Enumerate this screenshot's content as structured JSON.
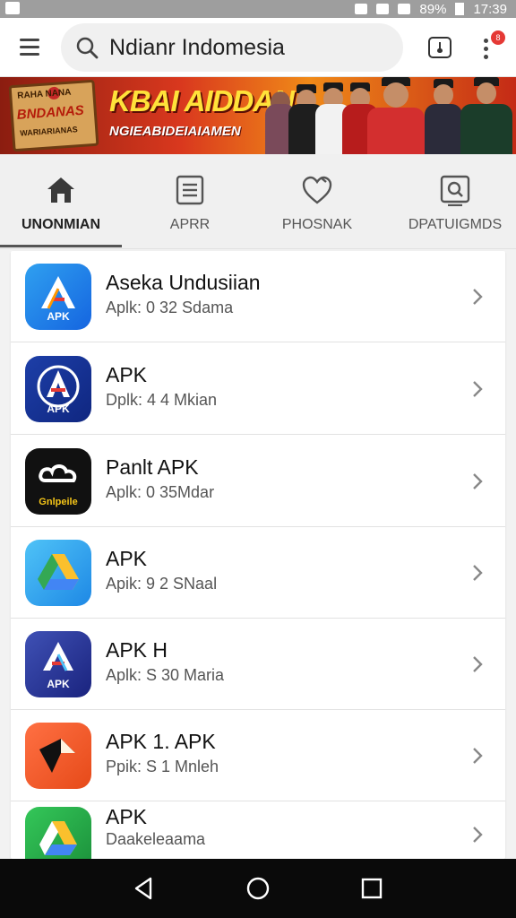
{
  "status_bar": {
    "battery": "89%",
    "time": "17:39"
  },
  "top_bar": {
    "search_value": "Ndianr Indomesia",
    "notification_count": "8"
  },
  "banner": {
    "sign_line1": "RAHA NANA",
    "sign_line2": "BNDANAS",
    "sign_line3": "WARIARIANAS",
    "title": "KBAI AIDDAN",
    "subtitle": "NGIEABIDEIAIAMEN"
  },
  "tabs": [
    {
      "label": "UNONMIAN",
      "icon": "home-icon",
      "active": true
    },
    {
      "label": "APRR",
      "icon": "document-icon",
      "active": false
    },
    {
      "label": "PHOSNAK",
      "icon": "heart-icon",
      "active": false
    },
    {
      "label": "DPATUIGMDS",
      "icon": "search-window-icon",
      "active": false
    }
  ],
  "apps": [
    {
      "name": "Aseka Undusiian",
      "meta": "Aplk: 0 32 Sdama",
      "icon": "apk-icon-blue",
      "caption": "APK",
      "colors": [
        "#2fa0f0",
        "#1565e0"
      ]
    },
    {
      "name": "APK",
      "meta": "Dplk: 4 4 Mkian",
      "icon": "apk-icon-navy",
      "caption": "APK",
      "colors": [
        "#1d3fa8",
        "#0f2680"
      ]
    },
    {
      "name": "Panlt APK",
      "meta": "Aplk: 0 35Mdar",
      "icon": "cloud-icon-black",
      "caption": "Gnlpeile",
      "colors": [
        "#151515",
        "#000000"
      ]
    },
    {
      "name": "APK",
      "meta": "Apik: 9 2 SNaal",
      "icon": "drive-icon-cyan",
      "caption": "",
      "colors": [
        "#4fc3f7",
        "#1e88e5"
      ]
    },
    {
      "name": "APK H",
      "meta": "Aplk: S 30 Maria",
      "icon": "apk-icon-indigo",
      "caption": "APK",
      "colors": [
        "#3f51b5",
        "#1a237e"
      ]
    },
    {
      "name": "APK 1. APK",
      "meta": "Ppik: S 1 Mnleh",
      "icon": "apk-icon-orange",
      "caption": "",
      "colors": [
        "#ff7043",
        "#e64a19"
      ]
    },
    {
      "name": "APK",
      "meta": "Daakeleaama",
      "icon": "drive-icon-green",
      "caption": "",
      "colors": [
        "#34c759",
        "#1b8f3a"
      ]
    }
  ]
}
